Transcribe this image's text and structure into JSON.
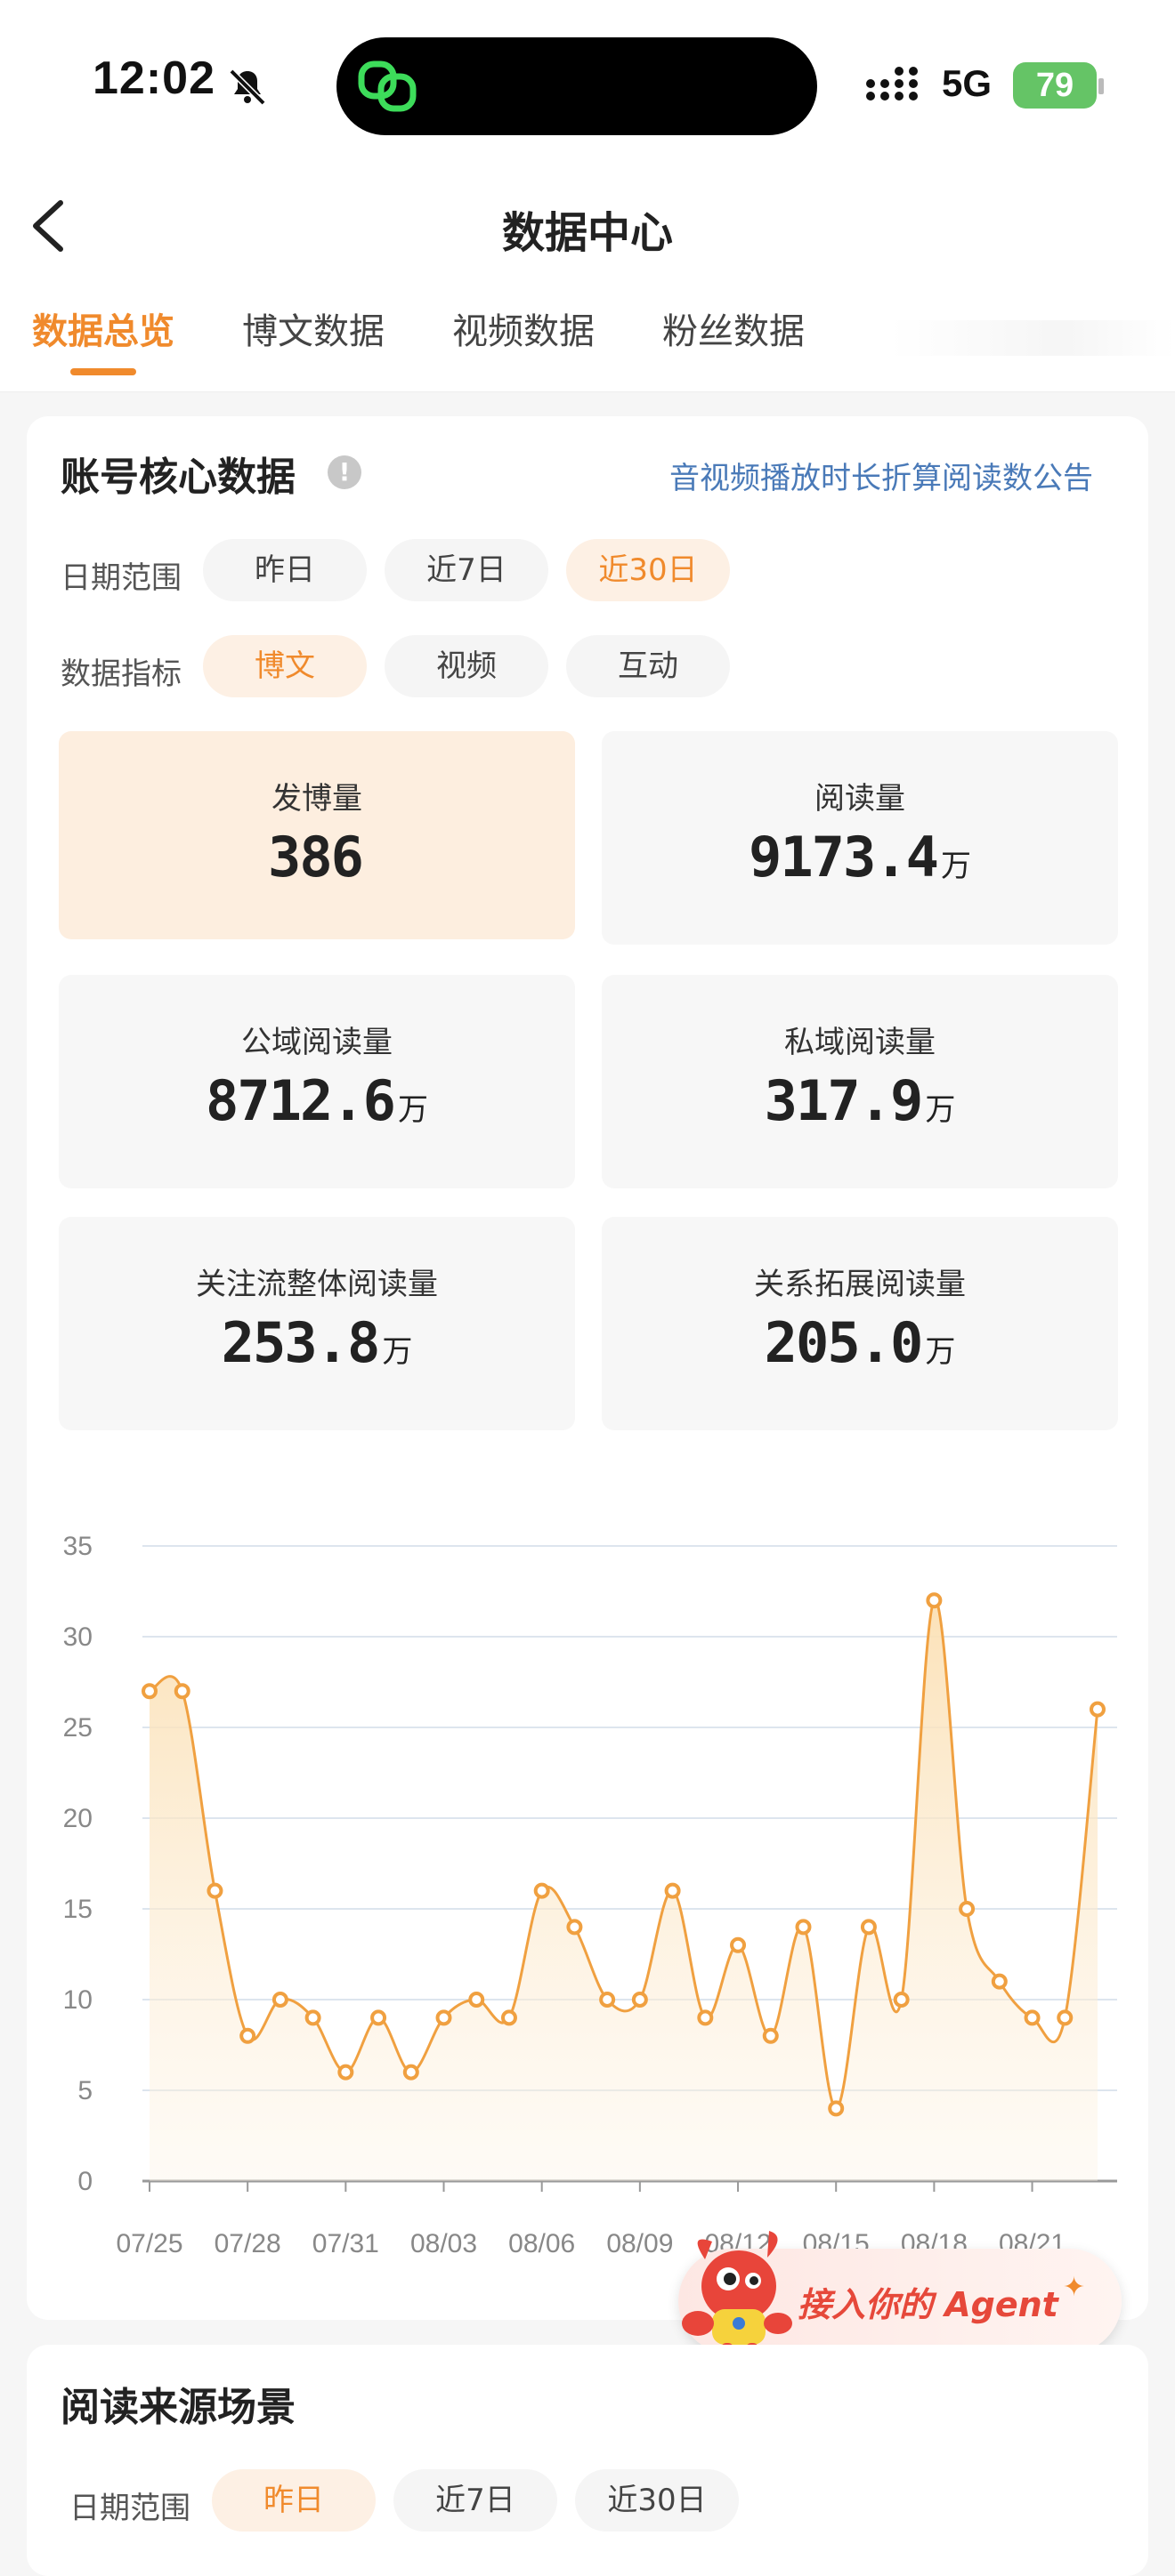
{
  "status_bar": {
    "time": "12:02",
    "network": "5G",
    "battery": "79"
  },
  "header": {
    "title": "数据中心",
    "tabs": [
      {
        "label": "数据总览",
        "active": true
      },
      {
        "label": "博文数据",
        "active": false
      },
      {
        "label": "视频数据",
        "active": false
      },
      {
        "label": "粉丝数据",
        "active": false
      }
    ]
  },
  "core": {
    "title": "账号核心数据",
    "notice_link": "音视频播放时长折算阅读数公告",
    "date_range": {
      "label": "日期范围",
      "options": [
        "昨日",
        "近7日",
        "近30日"
      ],
      "selected": "近30日"
    },
    "metric_type": {
      "label": "数据指标",
      "options": [
        "博文",
        "视频",
        "互动"
      ],
      "selected": "博文"
    },
    "metrics": [
      {
        "label": "发博量",
        "value": "386",
        "unit": ""
      },
      {
        "label": "阅读量",
        "value": "9173.4",
        "unit": "万"
      },
      {
        "label": "公域阅读量",
        "value": "8712.6",
        "unit": "万"
      },
      {
        "label": "私域阅读量",
        "value": "317.9",
        "unit": "万"
      },
      {
        "label": "关注流整体阅读量",
        "value": "253.8",
        "unit": "万"
      },
      {
        "label": "关系拓展阅读量",
        "value": "205.0",
        "unit": "万"
      }
    ]
  },
  "chart_data": {
    "type": "area",
    "x_tick_labels": [
      "07/25",
      "07/28",
      "07/31",
      "08/03",
      "08/06",
      "08/09",
      "08/12",
      "08/15",
      "08/18",
      "08/21"
    ],
    "ylim": [
      0,
      35
    ],
    "yticks": [
      0,
      5,
      10,
      15,
      20,
      25,
      30,
      35
    ],
    "x": [
      "07/25",
      "07/26",
      "07/27",
      "07/28",
      "07/29",
      "07/30",
      "07/31",
      "08/01",
      "08/02",
      "08/03",
      "08/04",
      "08/05",
      "08/06",
      "08/07",
      "08/08",
      "08/09",
      "08/10",
      "08/11",
      "08/12",
      "08/13",
      "08/14",
      "08/15",
      "08/16",
      "08/17",
      "08/18",
      "08/19",
      "08/20",
      "08/21",
      "08/22",
      "08/23"
    ],
    "values": [
      27,
      27,
      16,
      8,
      10,
      9,
      6,
      9,
      6,
      9,
      10,
      9,
      16,
      14,
      10,
      10,
      16,
      9,
      13,
      8,
      14,
      4,
      14,
      10,
      32,
      15,
      11,
      9,
      9,
      26
    ],
    "grid": true,
    "line_color": "#f0a040",
    "fill_color": "#fbe3bd"
  },
  "agent": {
    "label": "接入你的 Agent"
  },
  "sources": {
    "title": "阅读来源场景",
    "date_range": {
      "label": "日期范围",
      "options": [
        "昨日",
        "近7日",
        "近30日"
      ],
      "selected": "昨日"
    }
  }
}
